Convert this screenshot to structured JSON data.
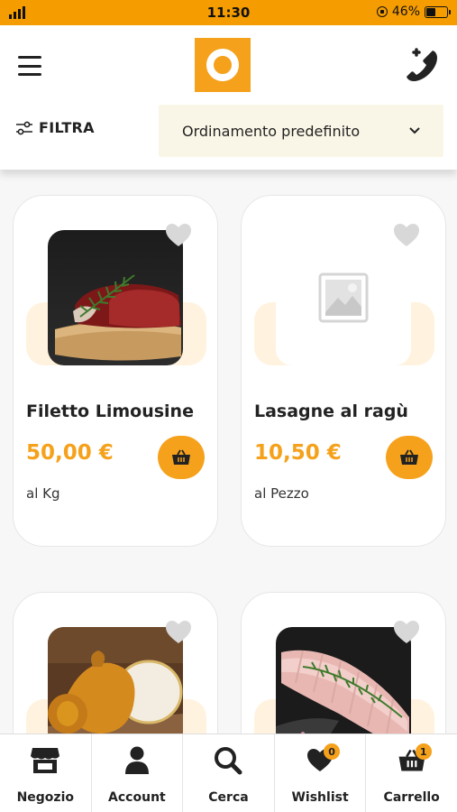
{
  "status_bar": {
    "time": "11:30",
    "battery_percent_label": "46%",
    "battery_level": 0.46,
    "signal_icon": "signal-bars-icon",
    "lock_icon": "orientation-lock-icon"
  },
  "header": {
    "menu_icon": "hamburger-menu-icon",
    "logo_icon": "orange-ring-logo",
    "phone_icon": "phone-add-icon",
    "filter_label": "FILTRA",
    "sort_label": "Ordinamento predefinito"
  },
  "colors": {
    "accent": "#f5a11b",
    "status_bar": "#f59c00",
    "sort_bg": "#faf6e7",
    "card_shape": "#fff3df"
  },
  "products": [
    {
      "name": "Filetto Limousine",
      "price": "50,00 €",
      "unit": "al Kg",
      "image": "raw-beef-fillet-photo"
    },
    {
      "name": "Lasagne al ragù",
      "price": "10,50 €",
      "unit": "al Pezzo",
      "image": "placeholder-image"
    },
    {
      "name": "",
      "price": "",
      "unit": "",
      "image": "smoked-cheese-photo"
    },
    {
      "name": "",
      "price": "",
      "unit": "",
      "image": "pork-roast-photo"
    }
  ],
  "bottom_nav": [
    {
      "label": "Negozio",
      "icon": "store-icon"
    },
    {
      "label": "Account",
      "icon": "user-icon"
    },
    {
      "label": "Cerca",
      "icon": "search-icon"
    },
    {
      "label": "Wishlist",
      "icon": "heart-icon",
      "badge": "0"
    },
    {
      "label": "Carrello",
      "icon": "basket-icon",
      "badge": "1"
    }
  ]
}
